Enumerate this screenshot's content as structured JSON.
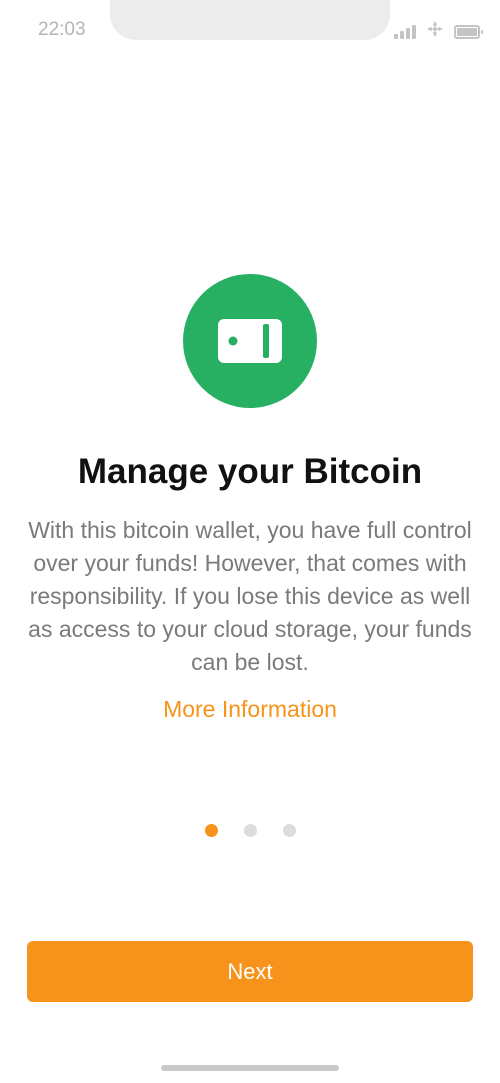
{
  "status_bar": {
    "time": "22:03",
    "icons": [
      "signal-icon",
      "wifi-icon",
      "battery-icon"
    ]
  },
  "onboarding": {
    "icon": "wallet-icon",
    "title": "Manage your Bitcoin",
    "description": "With this bitcoin wallet, you have full control over your funds! However, that comes with responsibility. If you lose this device as well as access to your cloud storage, your funds can be lost.",
    "more_info_label": "More Information",
    "page_count": 3,
    "active_page": 1,
    "next_label": "Next"
  },
  "colors": {
    "accent": "#f7931a",
    "icon_bg": "#27b062",
    "title": "#111111",
    "text": "#7a7a7a",
    "dot_inactive": "#dcdcdc"
  }
}
